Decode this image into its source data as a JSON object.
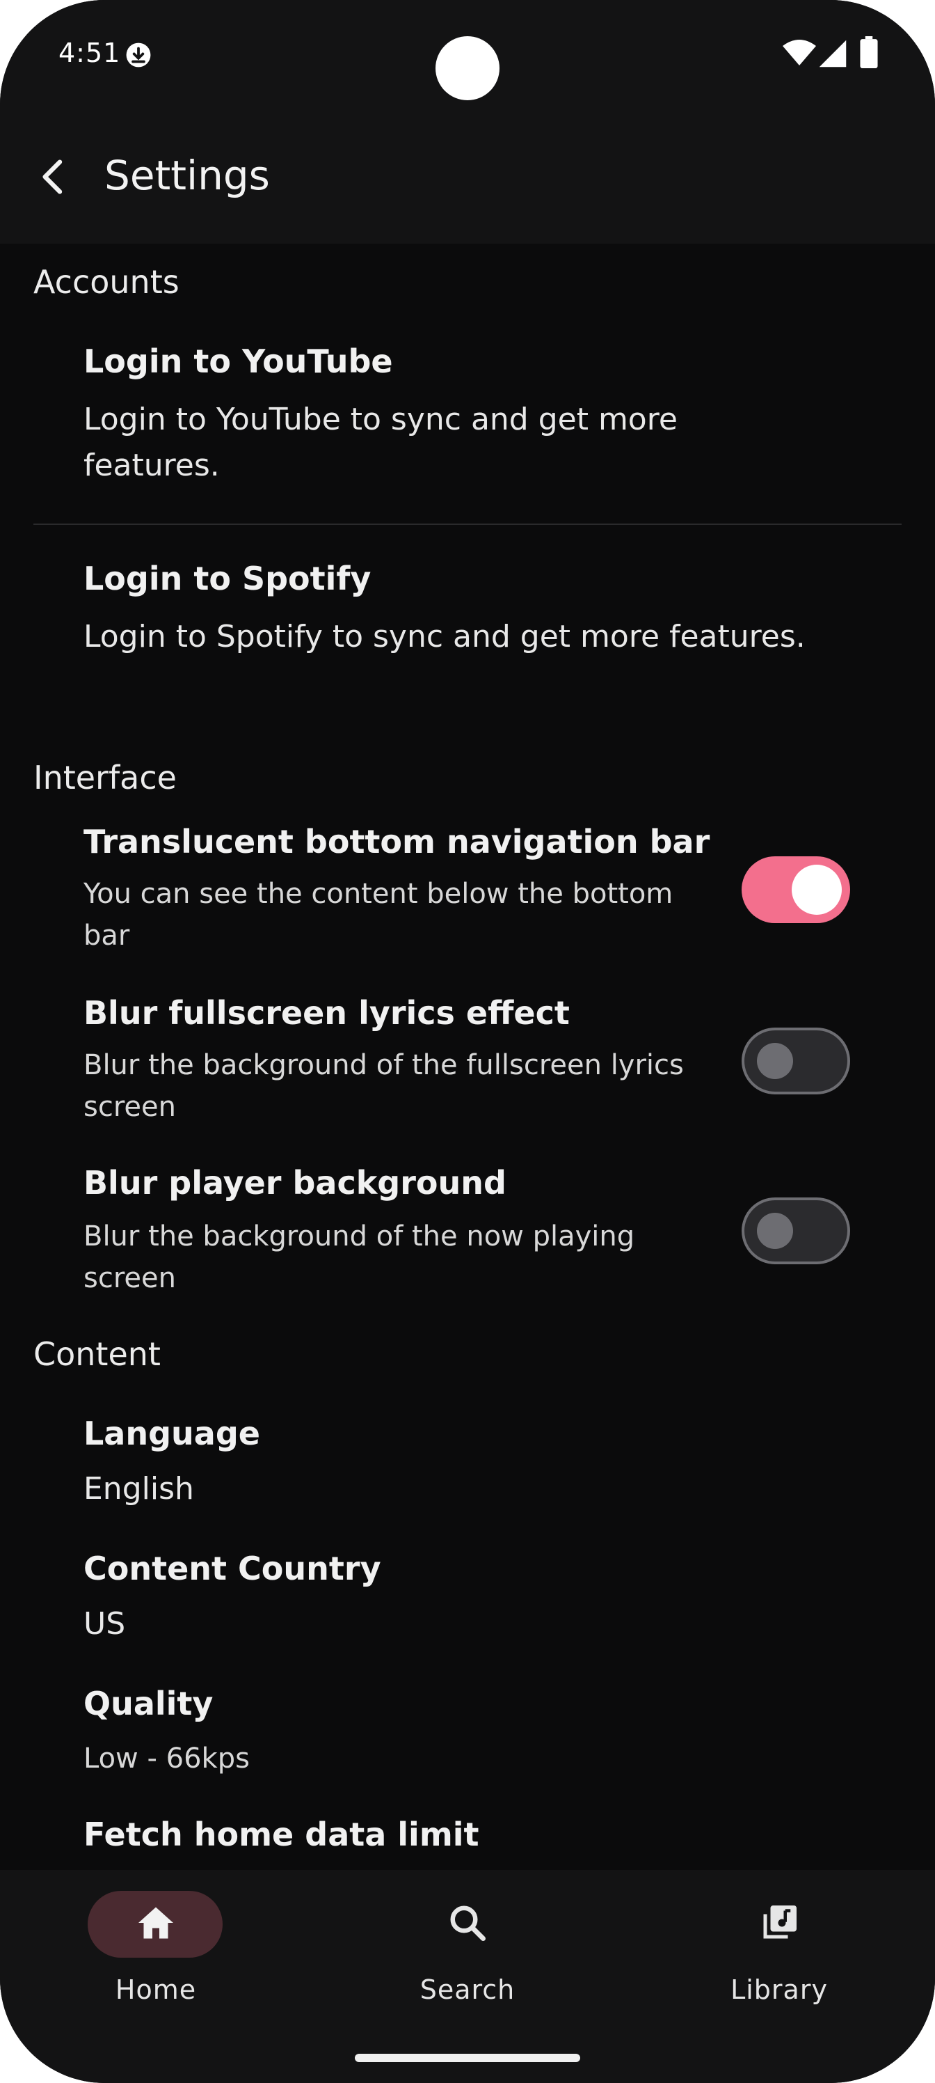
{
  "status_bar": {
    "time": "4:51"
  },
  "app_bar": {
    "title": "Settings"
  },
  "sections": {
    "accounts": {
      "title": "Accounts",
      "youtube": {
        "title": "Login to YouTube",
        "subtitle": "Login to YouTube to sync and get more features."
      },
      "spotify": {
        "title": "Login to Spotify",
        "subtitle": "Login to Spotify to sync and get more features."
      }
    },
    "interface": {
      "title": "Interface",
      "translucent_nav": {
        "title": "Translucent bottom navigation bar",
        "subtitle": "You can see the content below the bottom bar",
        "enabled": true
      },
      "blur_lyrics": {
        "title": "Blur fullscreen lyrics effect",
        "subtitle": "Blur the background of the fullscreen lyrics screen",
        "enabled": false
      },
      "blur_player": {
        "title": "Blur player background",
        "subtitle": "Blur the background of the now playing screen",
        "enabled": false
      }
    },
    "content": {
      "title": "Content",
      "language": {
        "title": "Language",
        "value": "English"
      },
      "country": {
        "title": "Content Country",
        "value": "US"
      },
      "quality": {
        "title": "Quality",
        "value": "Low - 66kps"
      },
      "fetch_limit": {
        "title": "Fetch home data limit"
      }
    }
  },
  "bottom_nav": {
    "home": "Home",
    "search": "Search",
    "library": "Library",
    "active": "home"
  },
  "colors": {
    "accent": "#f36f8d",
    "background": "#0b0b0c",
    "surface": "#131314",
    "nav_pill": "#4a2a30"
  }
}
